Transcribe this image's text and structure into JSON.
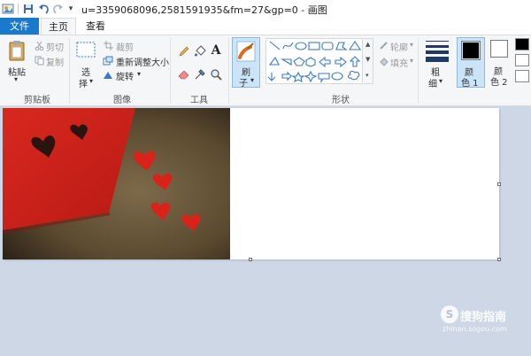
{
  "window": {
    "title": "u=3359068096,2581591935&fm=27&gp=0 - 画图"
  },
  "tabs": {
    "file": "文件",
    "home": "主页",
    "view": "查看"
  },
  "clipboard": {
    "paste": "粘贴",
    "cut": "剪切",
    "copy": "复制",
    "group": "剪贴板"
  },
  "image": {
    "select_1": "选",
    "select_2": "择",
    "crop": "裁剪",
    "resize": "重新调整大小",
    "rotate": "旋转",
    "group": "图像"
  },
  "tools": {
    "group": "工具",
    "text_glyph": "A"
  },
  "brushes": {
    "label_1": "刷",
    "label_2": "子"
  },
  "shapes": {
    "group": "形状",
    "outline": "轮廓",
    "fill": "填充"
  },
  "size": {
    "label_1": "粗",
    "label_2": "细"
  },
  "colors": {
    "color1_1": "颜",
    "color1_2": "色 1",
    "color2_1": "颜",
    "color2_2": "色 2",
    "color1_value": "#000000",
    "color2_value": "#ffffff"
  },
  "watermark": {
    "text": "搜狗指南",
    "sub": "zhinan.sogou.com"
  }
}
